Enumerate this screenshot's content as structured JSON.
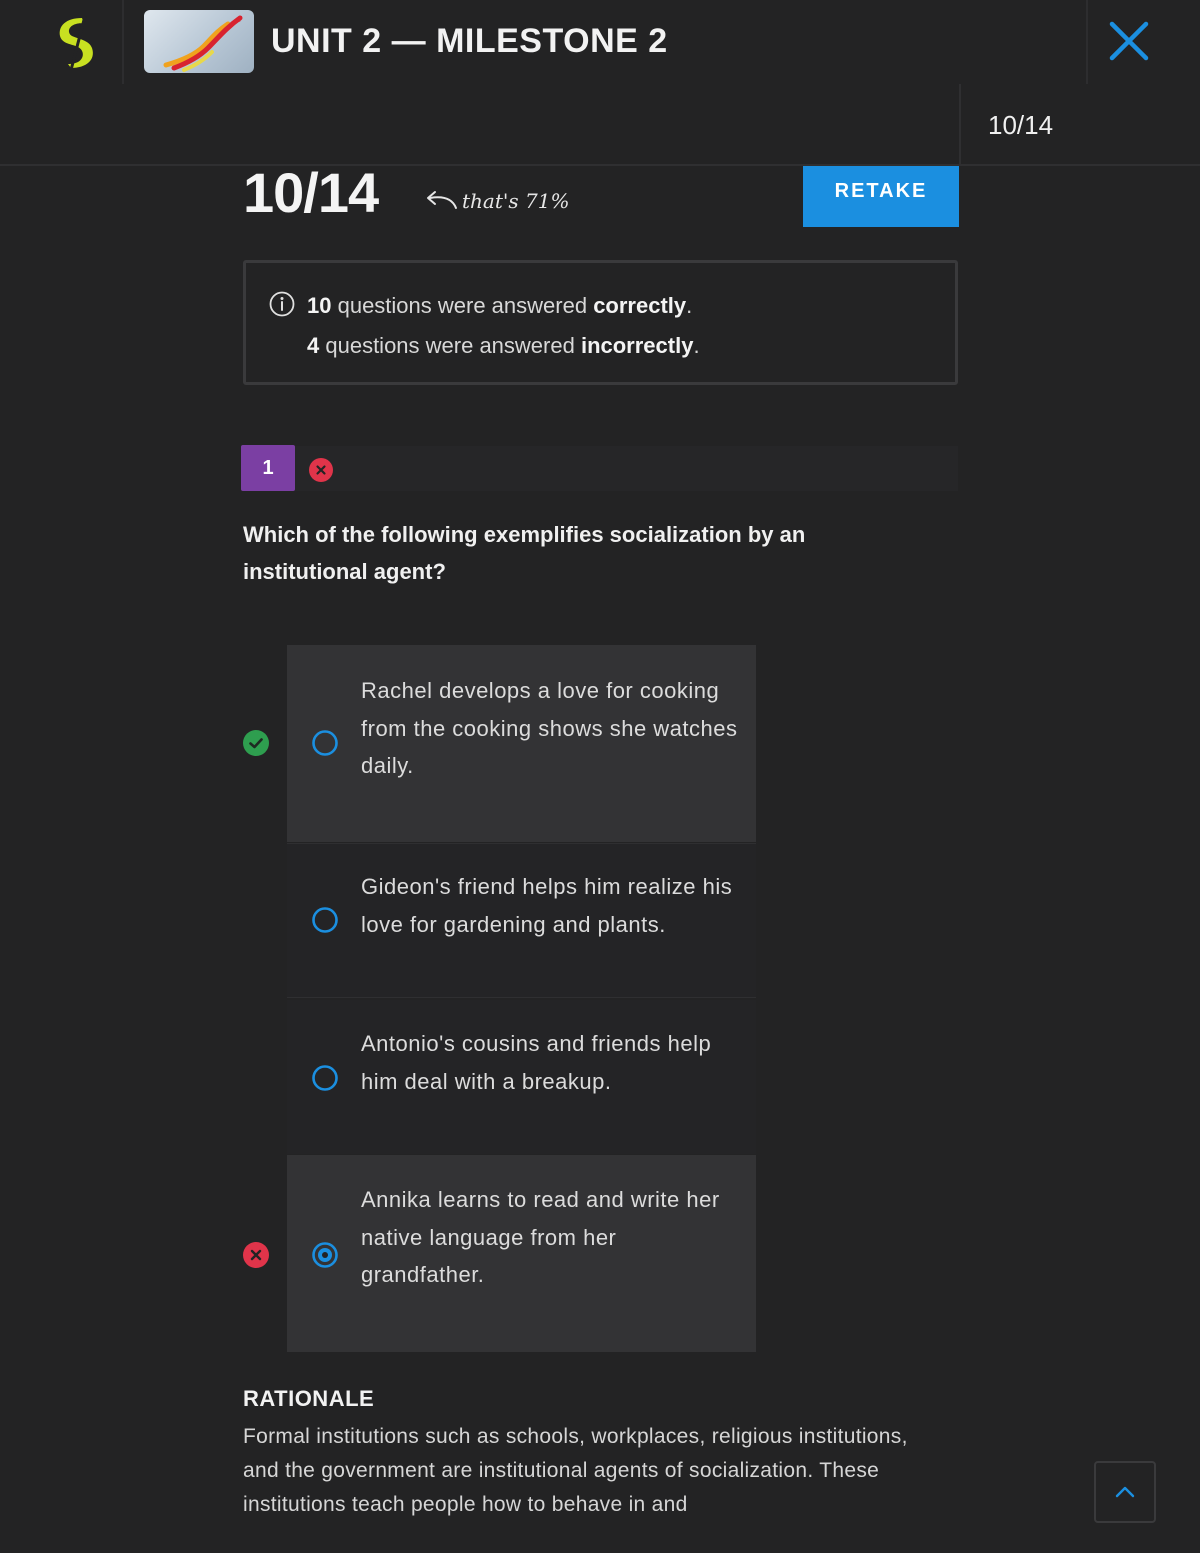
{
  "header": {
    "title": "UNIT 2 — MILESTONE 2",
    "score": "10/14"
  },
  "score": {
    "value": "10/14",
    "percent_note": "that's 71%",
    "retake_label": "RETAKE"
  },
  "summary": {
    "correct_count": "10",
    "correct_mid": " questions were answered ",
    "correct_word": "correctly",
    "incorrect_count": "4",
    "incorrect_mid": " questions were answered ",
    "incorrect_word": "incorrectly",
    "period": "."
  },
  "question": {
    "number": "1",
    "text": "Which of the following exemplifies socialization by an institutional agent?",
    "answers": [
      {
        "text": "Rachel develops a love for cooking from the cooking shows she watches daily.",
        "mark": "correct",
        "selected": false
      },
      {
        "text": "Gideon's friend helps him realize his love for gardening and plants.",
        "mark": "none",
        "selected": false
      },
      {
        "text": "Antonio's cousins and friends help him deal with a breakup.",
        "mark": "none",
        "selected": false
      },
      {
        "text": "Annika learns to read and write her native language from her grandfather.",
        "mark": "incorrect",
        "selected": true
      }
    ]
  },
  "rationale": {
    "title": "RATIONALE",
    "body": "Formal institutions such as schools, workplaces, religious institutions, and the government are institutional agents of socialization. These institutions teach people how to behave in and"
  },
  "colors": {
    "accent": "#1b8fe0",
    "correct": "#2e9e4f",
    "incorrect": "#e0344a",
    "question_badge": "#7b3fa3",
    "logo": "#c8e021"
  },
  "icons": {
    "logo": "sophia-logo-icon",
    "close": "close-icon",
    "info": "info-icon",
    "correct": "check-circle-icon",
    "incorrect": "x-circle-icon",
    "scroll_top": "chevron-up-icon"
  }
}
